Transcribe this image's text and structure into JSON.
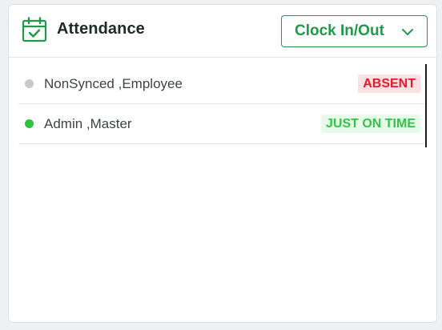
{
  "header": {
    "title": "Attendance",
    "icon": "calendar-check-icon",
    "clock_button_label": "Clock In/Out",
    "accent_color": "#1f9a48"
  },
  "rows": [
    {
      "name": "NonSynced ,Employee",
      "status": "ABSENT",
      "dot_color": "#c8c8c8",
      "badge_text_color": "#e8172a",
      "badge_bg_color": "#fde0e2"
    },
    {
      "name": "Admin ,Master",
      "status": "JUST ON TIME",
      "dot_color": "#2ec23f",
      "badge_text_color": "#36c24a",
      "badge_bg_color": "#e6fbe8"
    }
  ]
}
